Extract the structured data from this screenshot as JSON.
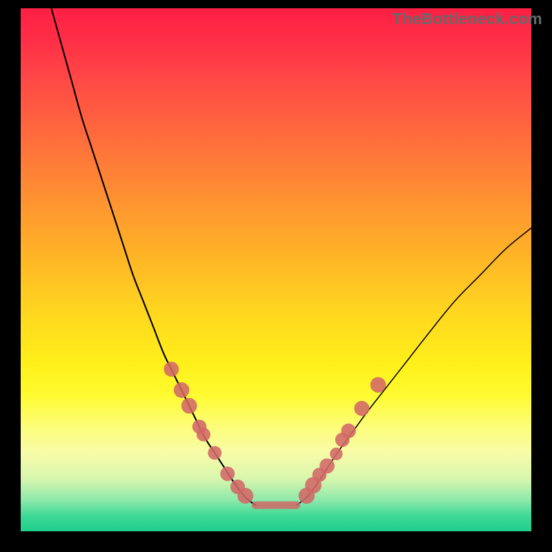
{
  "brand": "TheBottleneck.com",
  "colors": {
    "background": "#000000",
    "marker": "#d26866",
    "curve": "#000000"
  },
  "chart_data": {
    "type": "line",
    "title": "",
    "xlabel": "",
    "ylabel": "",
    "xlim": [
      0,
      100
    ],
    "ylim": [
      0,
      100
    ],
    "grid": false,
    "legend": false,
    "series": [
      {
        "name": "left-curve",
        "x": [
          6,
          8,
          10,
          12,
          14,
          16,
          18,
          20,
          22,
          24,
          26,
          28,
          30,
          32,
          34,
          36,
          38,
          40,
          42,
          44,
          46
        ],
        "y": [
          100,
          93,
          86,
          79,
          73,
          67,
          61,
          55,
          49,
          44,
          39,
          34,
          30,
          26,
          22,
          18,
          15,
          12,
          9,
          6.5,
          5
        ]
      },
      {
        "name": "right-curve",
        "x": [
          54,
          56,
          58,
          60,
          62,
          65,
          68,
          72,
          76,
          80,
          85,
          90,
          95,
          100
        ],
        "y": [
          5,
          6.5,
          9,
          12,
          15,
          19,
          23,
          28,
          33,
          38,
          44,
          49,
          54,
          58
        ]
      },
      {
        "name": "flat-minimum",
        "x": [
          46,
          54
        ],
        "y": [
          5,
          5
        ]
      }
    ],
    "markers_left": [
      {
        "x": 29.5,
        "y": 31
      },
      {
        "x": 31.5,
        "y": 27
      },
      {
        "x": 33.0,
        "y": 24
      },
      {
        "x": 35.0,
        "y": 20
      },
      {
        "x": 35.8,
        "y": 18.5
      },
      {
        "x": 38.0,
        "y": 15
      },
      {
        "x": 40.5,
        "y": 11
      },
      {
        "x": 42.5,
        "y": 8.5
      },
      {
        "x": 44.0,
        "y": 6.8
      }
    ],
    "markers_right": [
      {
        "x": 56.0,
        "y": 6.8
      },
      {
        "x": 57.3,
        "y": 8.8
      },
      {
        "x": 58.5,
        "y": 10.8
      },
      {
        "x": 60.0,
        "y": 12.5
      },
      {
        "x": 61.8,
        "y": 14.8
      },
      {
        "x": 63.0,
        "y": 17.5
      },
      {
        "x": 64.2,
        "y": 19.2
      },
      {
        "x": 66.8,
        "y": 23.5
      },
      {
        "x": 70.0,
        "y": 28.0
      }
    ],
    "marker_radius_range": [
      7,
      13
    ]
  }
}
